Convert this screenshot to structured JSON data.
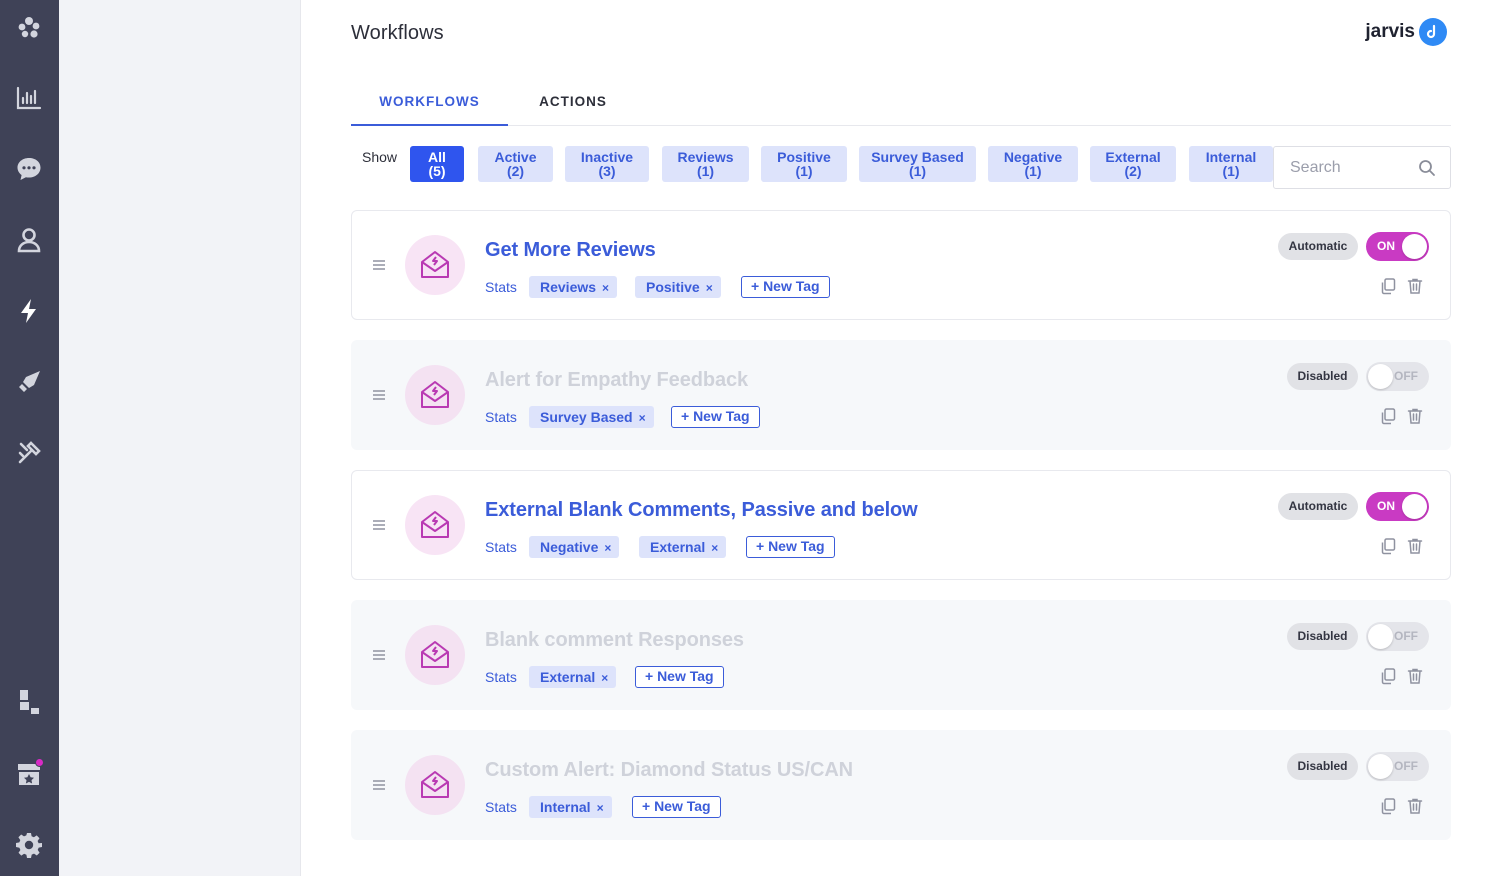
{
  "colors": {
    "rail_bg": "#3f4257",
    "accent": "#3b5cd9",
    "chip_selected": "#2f55ee",
    "toggle_on": "#c93ac3",
    "notification_dot": "#d92ac6"
  },
  "rail": {
    "icons": [
      "workspace-logo-icon",
      "analytics-icon",
      "chat-icon",
      "contacts-icon",
      "workflows-bolt-icon",
      "campaigns-rocket-icon",
      "tools-icon",
      "integrations-icon",
      "marketplace-icon",
      "settings-gear-icon"
    ],
    "active_icon": "workflows-bolt-icon"
  },
  "header": {
    "title": "Workflows",
    "brand": "jarvis"
  },
  "tabs": [
    {
      "label": "WORKFLOWS",
      "active": true
    },
    {
      "label": "ACTIONS",
      "active": false
    }
  ],
  "filters": {
    "show_label": "Show",
    "chips": [
      {
        "label": "All",
        "count": "(5)",
        "selected": true
      },
      {
        "label": "Active",
        "count": "(2)"
      },
      {
        "label": "Inactive",
        "count": "(3)"
      },
      {
        "label": "Reviews",
        "count": "(1)"
      },
      {
        "label": "Positive",
        "count": "(1)"
      },
      {
        "label": "Survey Based",
        "count": "(1)"
      },
      {
        "label": "Negative",
        "count": "(1)"
      },
      {
        "label": "External",
        "count": "(2)"
      },
      {
        "label": "Internal",
        "count": "(1)"
      }
    ],
    "search_placeholder": "Search"
  },
  "workflows": [
    {
      "title": "Get More Reviews",
      "stats_label": "Stats",
      "tags": [
        "Reviews",
        "Positive"
      ],
      "new_tag_label": "+ New Tag",
      "mode": "Automatic",
      "toggle_label": "ON",
      "enabled": true
    },
    {
      "title": "Alert for Empathy Feedback",
      "stats_label": "Stats",
      "tags": [
        "Survey Based"
      ],
      "new_tag_label": "+ New Tag",
      "mode": "Disabled",
      "toggle_label": "OFF",
      "enabled": false
    },
    {
      "title": "External Blank Comments, Passive and below",
      "stats_label": "Stats",
      "tags": [
        "Negative",
        "External"
      ],
      "new_tag_label": "+ New Tag",
      "mode": "Automatic",
      "toggle_label": "ON",
      "enabled": true
    },
    {
      "title": "Blank comment Responses",
      "stats_label": "Stats",
      "tags": [
        "External"
      ],
      "new_tag_label": "+ New Tag",
      "mode": "Disabled",
      "toggle_label": "OFF",
      "enabled": false
    },
    {
      "title": "Custom Alert: Diamond Status US/CAN",
      "stats_label": "Stats",
      "tags": [
        "Internal"
      ],
      "new_tag_label": "+ New Tag",
      "mode": "Disabled",
      "toggle_label": "OFF",
      "enabled": false
    }
  ],
  "tag_remove_glyph": "×"
}
